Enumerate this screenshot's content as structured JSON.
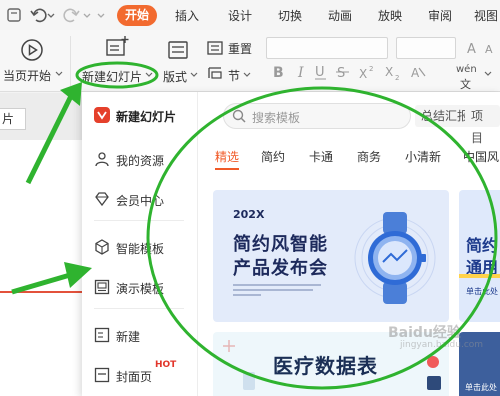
{
  "tabs": [
    "开始",
    "插入",
    "设计",
    "切换",
    "动画",
    "放映",
    "审阅",
    "视图"
  ],
  "active_tab": "开始",
  "ribbon": {
    "from_current": "当页开始",
    "new_slide": "新建幻灯片",
    "layout": "版式",
    "reset": "重置",
    "section": "节",
    "wen": "wén"
  },
  "thumb_label": "片",
  "side_menu": {
    "brand": "新建幻灯片",
    "items": [
      "我的资源",
      "会员中心",
      "智能模板",
      "演示模板",
      "新建",
      "封面页"
    ],
    "hot_badge": "HOT"
  },
  "search": {
    "placeholder": "搜索模板",
    "chips": [
      "总结汇报",
      "项目"
    ]
  },
  "categories": [
    "精选",
    "简约",
    "卡通",
    "商务",
    "小清新",
    "中国风"
  ],
  "active_category": "精选",
  "cards": {
    "card1": {
      "year": "202X",
      "line1": "简约风智能",
      "line2": "产品发布会"
    },
    "card2": {
      "line1": "简约",
      "line2": "通用",
      "sub": "单击此处"
    },
    "card3": {
      "title": "医疗数据表"
    },
    "card4": {
      "sub": "单击此处"
    }
  },
  "watermark": "Baidu经验",
  "watermark_sub": "jingyan.baidu.com",
  "colors": {
    "accent": "#f26a2f",
    "annotation_green": "#2fb32f",
    "card_navy": "#1d2a5c"
  }
}
